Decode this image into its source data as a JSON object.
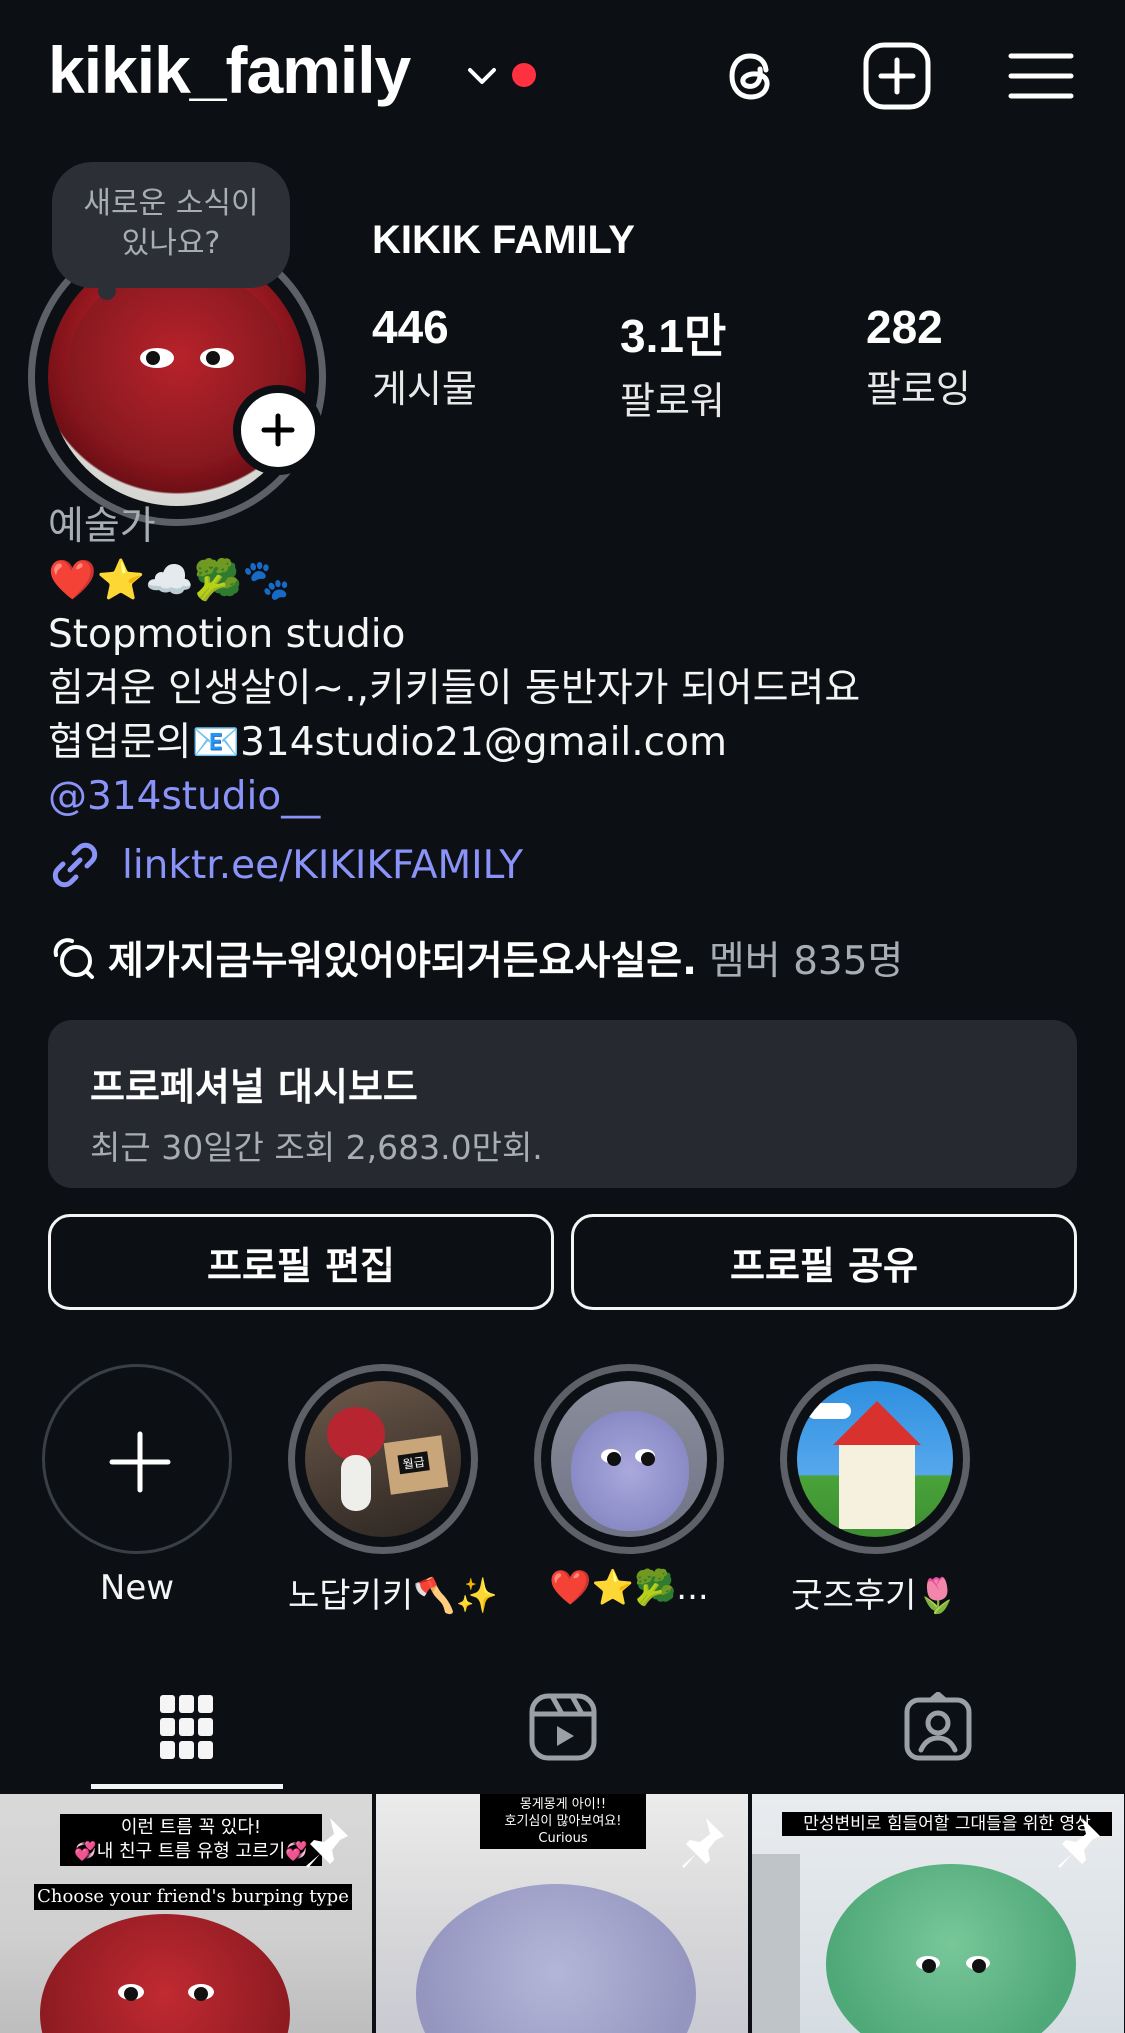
{
  "header": {
    "username": "kikik_family",
    "icons": [
      "threads-icon",
      "create-plus-icon",
      "menu-icon"
    ]
  },
  "profile": {
    "note_bubble": "새로운 소식이\n있나요?",
    "full_name": "KIKIK FAMILY",
    "stats": [
      {
        "value": "446",
        "label": "게시물"
      },
      {
        "value": "3.1만",
        "label": "팔로워"
      },
      {
        "value": "282",
        "label": "팔로잉"
      }
    ]
  },
  "bio": {
    "category": "예술가",
    "emoji_line": "❤️⭐️☁️🥦🐾",
    "line1": "Stopmotion studio",
    "line2": "힘겨운 인생살이~.,키키들이 동반자가 되어드려요",
    "line3": "협업문의📧314studio21@gmail.com",
    "mention": "@314studio__",
    "link": "linktr.ee/KIKIKFAMILY",
    "channel_name": "제가지금누워있어야되거든요사실은.",
    "channel_members": "멤버 835명"
  },
  "dashboard": {
    "title": "프로페셔널 대시보드",
    "subtitle": "최근 30일간 조회 2,683.0만회."
  },
  "buttons": {
    "edit": "프로필 편집",
    "share": "프로필 공유"
  },
  "highlights": [
    {
      "label": "New"
    },
    {
      "label": "노답키키🪓✨"
    },
    {
      "label": "❤️⭐️🥦..."
    },
    {
      "label": "굿즈후기🌷"
    }
  ],
  "tabs": [
    "grid-icon",
    "reels-icon",
    "tagged-icon"
  ],
  "posts": [
    {
      "caption_top": "이런 트름 꼭 있다!\n💞내 친구 트름 유형 고르기💞",
      "caption_bottom": "Choose your friend's burping type"
    },
    {
      "caption_top": "몽게몽게 아이!!\n호기심이 많아보여요!\nCurious"
    },
    {
      "caption_top": "만성변비로 힘들어할 그대들을 위한 영상"
    }
  ],
  "highlight_sticker": "월급",
  "colors": {
    "background": "#0c1014",
    "link": "#8a93f8",
    "notification_dot": "#ff3040",
    "card": "#262a30"
  }
}
